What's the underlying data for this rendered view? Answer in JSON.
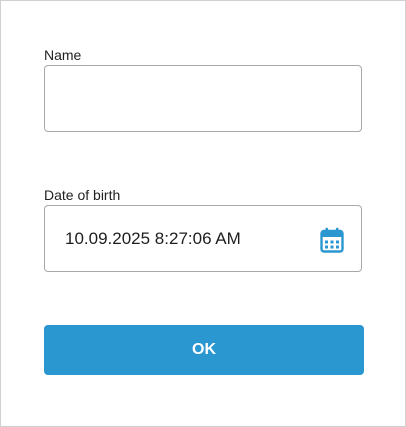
{
  "form": {
    "name_label": "Name",
    "name_value": "",
    "dob_label": "Date of birth",
    "dob_value": "10.09.2025 8:27:06 AM",
    "ok_label": "OK"
  },
  "icons": {
    "calendar": "calendar-icon"
  },
  "colors": {
    "accent": "#2a97d0",
    "border": "#a8a8a8",
    "frame_border": "#d0d0d0"
  }
}
